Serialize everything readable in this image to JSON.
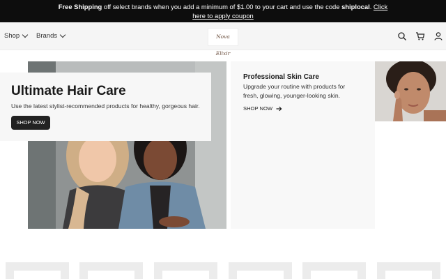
{
  "promo": {
    "lead_bold": "Free Shipping",
    "text_1": " off select brands when you add a minimum of $1.00 to your cart and use the code ",
    "code": "shiplocal",
    "text_2": ". ",
    "link": "Click here to apply coupon"
  },
  "nav": {
    "shop_label": "Shop",
    "brands_label": "Brands",
    "logo_text": "Nova Elixir",
    "icons": [
      "search-icon",
      "cart-icon",
      "account-icon"
    ]
  },
  "hero": {
    "title": "Ultimate Hair Care",
    "subtitle": "Use the latest stylist-recommended products for healthy, gorgeous hair.",
    "button": "SHOP NOW"
  },
  "skin": {
    "title": "Professional Skin Care",
    "subtitle": "Upgrade your routine with products for fresh, glowing, younger-looking skin.",
    "link": "SHOP NOW"
  },
  "colors": {
    "promo_bg": "#0d0d0d",
    "nav_bg": "#f5f5f5",
    "button_bg": "#222222"
  }
}
